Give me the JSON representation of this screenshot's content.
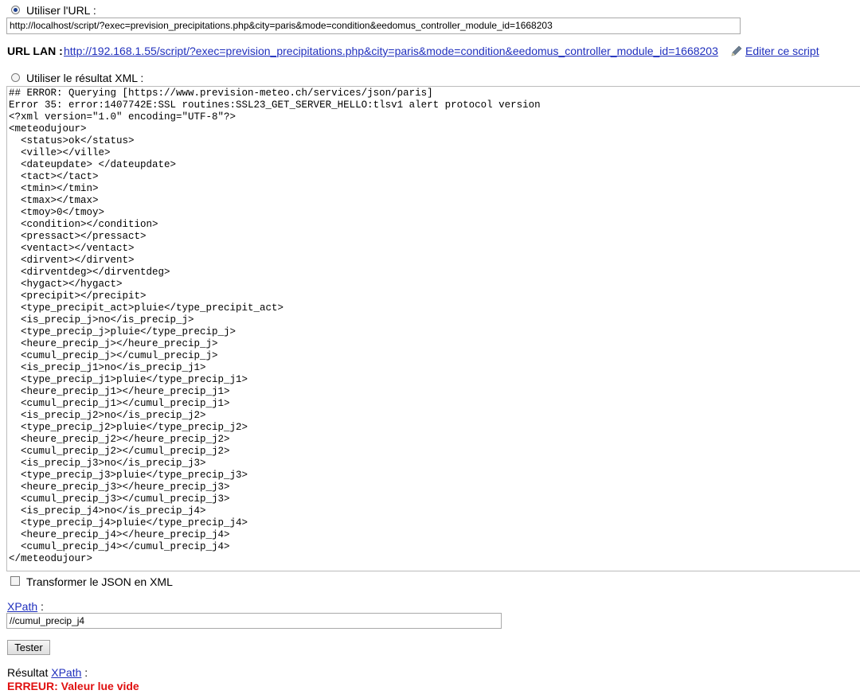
{
  "url_option": {
    "label": "Utiliser l'URL :",
    "selected": true,
    "url_value": "http://localhost/script/?exec=prevision_precipitations.php&city=paris&mode=condition&eedomus_controller_module_id=1668203"
  },
  "url_lan": {
    "label": "URL LAN :",
    "link": "http://192.168.1.55/script/?exec=prevision_precipitations.php&city=paris&mode=condition&eedomus_controller_module_id=1668203",
    "edit_icon": "pencil-icon",
    "edit_label": "Editer ce script"
  },
  "xml_option": {
    "label": "Utiliser le résultat XML :",
    "selected": false,
    "content": "## ERROR: Querying [https://www.prevision-meteo.ch/services/json/paris]\nError 35: error:1407742E:SSL routines:SSL23_GET_SERVER_HELLO:tlsv1 alert protocol version\n<?xml version=\"1.0\" encoding=\"UTF-8\"?>\n<meteodujour>\n  <status>ok</status>\n  <ville></ville>\n  <dateupdate> </dateupdate>\n  <tact></tact>\n  <tmin></tmin>\n  <tmax></tmax>\n  <tmoy>0</tmoy>\n  <condition></condition>\n  <pressact></pressact>\n  <ventact></ventact>\n  <dirvent></dirvent>\n  <dirventdeg></dirventdeg>\n  <hygact></hygact>\n  <precipit></precipit>\n  <type_precipit_act>pluie</type_precipit_act>\n  <is_precip_j>no</is_precip_j>\n  <type_precip_j>pluie</type_precip_j>\n  <heure_precip_j></heure_precip_j>\n  <cumul_precip_j></cumul_precip_j>\n  <is_precip_j1>no</is_precip_j1>\n  <type_precip_j1>pluie</type_precip_j1>\n  <heure_precip_j1></heure_precip_j1>\n  <cumul_precip_j1></cumul_precip_j1>\n  <is_precip_j2>no</is_precip_j2>\n  <type_precip_j2>pluie</type_precip_j2>\n  <heure_precip_j2></heure_precip_j2>\n  <cumul_precip_j2></cumul_precip_j2>\n  <is_precip_j3>no</is_precip_j3>\n  <type_precip_j3>pluie</type_precip_j3>\n  <heure_precip_j3></heure_precip_j3>\n  <cumul_precip_j3></cumul_precip_j3>\n  <is_precip_j4>no</is_precip_j4>\n  <type_precip_j4>pluie</type_precip_j4>\n  <heure_precip_j4></heure_precip_j4>\n  <cumul_precip_j4></cumul_precip_j4>\n</meteodujour>"
  },
  "transform": {
    "label": "Transformer le JSON en XML",
    "checked": false
  },
  "xpath": {
    "link": "XPath",
    "suffix": " :",
    "value": "//cumul_precip_j4"
  },
  "test_button": {
    "label": "Tester"
  },
  "result": {
    "prefix": "Résultat ",
    "link": "XPath",
    "suffix": " :",
    "error": "ERREUR: Valeur lue vide"
  },
  "colors": {
    "link": "#1f2fbd",
    "error": "#e01010"
  }
}
